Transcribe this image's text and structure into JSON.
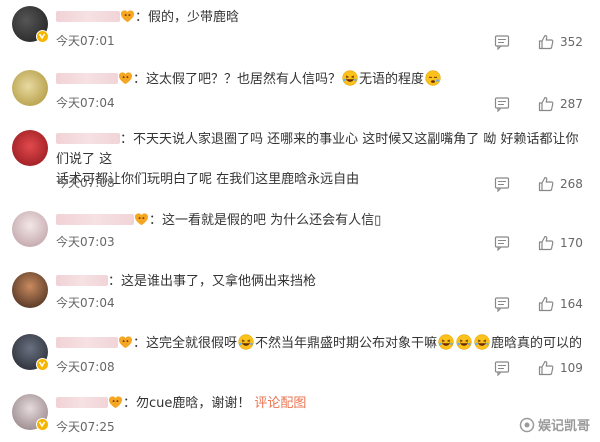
{
  "comments": [
    {
      "username_masked": true,
      "text": "：假的，少带鹿晗",
      "time": "今天07:01",
      "likes": "352",
      "avatar_color": "#2b2b2b"
    },
    {
      "username_masked": true,
      "text_parts": [
        "：这太假了吧？？也居然有人信吗？",
        "无语的程度"
      ],
      "time": "今天07:04",
      "likes": "287",
      "avatar_color": "#c9b35a"
    },
    {
      "username_masked": true,
      "line1": "：不天天说人家退圈了吗 还哪来的事业心 这时候又这副嘴角了 呦 好赖话都让你们说了 这",
      "line2": "话术可都让你们玩明白了呢 在我们这里鹿晗永远自由",
      "time": "今天07:08",
      "likes": "268",
      "avatar_color": "#c2282c"
    },
    {
      "username_masked": true,
      "text": "：这一看就是假的吧 为什么还会有人信▯",
      "time": "今天07:03",
      "likes": "170",
      "avatar_color": "#d9c6c8"
    },
    {
      "username_masked": true,
      "text": "：这是谁出事了，又拿他俩出来挡枪",
      "time": "今天07:04",
      "likes": "164",
      "avatar_color": "#7a4a2f"
    },
    {
      "username_masked": true,
      "text_parts": [
        "：这完全就很假呀",
        "不然当年鼎盛时期公布对象干嘛",
        "鹿晗真的可以的"
      ],
      "time": "今天07:08",
      "likes": "109",
      "avatar_color": "#3a3f4a"
    },
    {
      "username_masked": true,
      "text": "：勿cue鹿晗，谢谢！",
      "link": "评论配图",
      "time": "今天07:25",
      "likes": "",
      "avatar_color": "#b6aeb0"
    }
  ],
  "watermark": "娱记凯哥",
  "colors": {
    "link": "#eb7350",
    "badge": "#f7b500",
    "meta": "#666666"
  },
  "icons": {
    "reply": "comment-icon",
    "like": "thumbs-up-icon",
    "verified": "v-badge-icon",
    "emoji": "laughing-emoji-icon"
  }
}
